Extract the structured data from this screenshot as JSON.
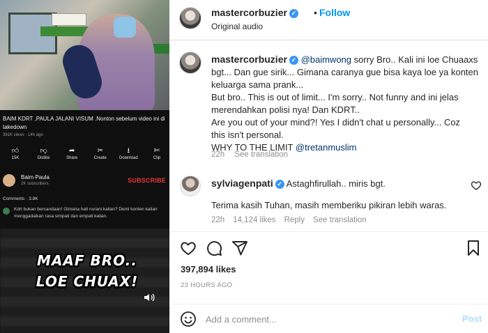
{
  "media": {
    "video_title": "BAIM KDRT ,PAULA JALANI VISUM .Nonton sebelum video ini di takedown",
    "video_meta": "391K views · 14h ago",
    "actions": [
      {
        "icon": "thumbs-up-icon",
        "label": "15K"
      },
      {
        "icon": "thumbs-down-icon",
        "label": "Dislike"
      },
      {
        "icon": "share-icon",
        "label": "Share"
      },
      {
        "icon": "create-icon",
        "label": "Create"
      },
      {
        "icon": "download-icon",
        "label": "Download"
      },
      {
        "icon": "clip-icon",
        "label": "Clip"
      }
    ],
    "channel_name": "Baim Paula",
    "channel_subs": "2K subscribers",
    "subscribe_label": "SUBSCRIBE",
    "comments_header": "Comments · 3.8K",
    "top_comment": "Kdrt bukan bercandaan! Gimana hati nurani kalian? Demi konten kalian menggadaikan rasa simpati dan empati kalian.",
    "meme_line1": "MAAF BRO..",
    "meme_line2": "LOE CHUAX!"
  },
  "header": {
    "username": "mastercorbuzier",
    "separator": "•",
    "follow_label": "Follow",
    "audio": "Original audio"
  },
  "caption": {
    "username": "mastercorbuzier",
    "mention1": "@baimwong",
    "line1_rest": " sorry Bro.. Kali ini loe Chuaaxs",
    "line2": "bgt... Dan gue sirik... Gimana caranya gue bisa kaya loe ya konten",
    "line3": "keluarga sama prank...",
    "line4": "But bro.. This is out of limit... I'm sorry.. Not funny and ini jelas",
    "line5": "merendahkan polisi nya! Dan KDRT..",
    "line6": "Are you out of your mind?! Yes I didn't chat u personally... Coz",
    "line7": "this isn't personal.",
    "line8_prefix": "WHY TO THE LIMIT ",
    "mention2": "@tretanmuslim",
    "time": "22h",
    "see_translation": "See translation"
  },
  "comment": {
    "username": "sylviagenpati",
    "text": " Astaghfirullah.. miris bgt.",
    "text2": "Terima kasih Tuhan, masih memberiku pikiran lebih waras.",
    "time": "22h",
    "likes": "14,124 likes",
    "reply": "Reply",
    "see_translation": "See translation"
  },
  "engagement": {
    "likes": "397,894 likes",
    "timestamp": "23 HOURS AGO"
  },
  "add_comment": {
    "placeholder": "Add a comment...",
    "post_label": "Post"
  },
  "colors": {
    "link_blue": "#0095f6",
    "verified_blue": "#3897f0",
    "mention": "#00376b",
    "muted": "#8e8e8e",
    "subscribe_red": "#e53935"
  }
}
